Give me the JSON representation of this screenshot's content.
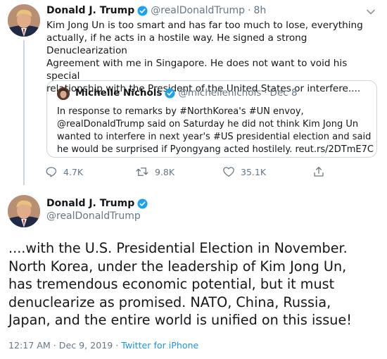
{
  "tweet1": {
    "name": "Donald J. Trump",
    "handle": "@realDonaldTrump",
    "separator": "·",
    "time": "8h",
    "lines": [
      "Kim Jong Un is too smart and has far too much to lose, everything",
      "actually, if he acts in a hostile way. He signed a strong Denuclearization",
      "Agreement with me in Singapore. He does not want to void his special",
      "relationship with the President of the United States or interfere...."
    ],
    "quote": {
      "name": "Michelle Nichols",
      "handle": "@michellenichols",
      "separator": "·",
      "time": "Dec 8",
      "lines": [
        "In response to remarks by #NorthKorea's #UN envoy,",
        "@realDonaldTrump said on Saturday he did not think Kim Jong Un",
        "wanted to interfere in next year's #US presidential election and said",
        "he would be surprised if Pyongyang acted hostilely. reut.rs/2DTmE7C"
      ]
    },
    "actions": {
      "reply_count": "4.7K",
      "retweet_count": "9.8K",
      "like_count": "35.1K"
    }
  },
  "tweet2": {
    "name": "Donald J. Trump",
    "handle": "@realDonaldTrump",
    "lines": [
      "....with the U.S. Presidential Election in November.",
      "North Korea, under the leadership of Kim Jong Un,",
      "has tremendous economic potential, but it must",
      "denuclearize as promised. NATO, China, Russia,",
      "Japan, and the entire world is unified on this issue!"
    ],
    "timestamp": "12:17 AM · Dec 9, 2019 · ",
    "source": "Twitter for iPhone"
  },
  "colors": {
    "accent": "#1da1f2",
    "text": "#14171a",
    "secondary": "#657786",
    "border": "#ccd6dd"
  },
  "icons": [
    "verified-badge-icon",
    "reply-icon",
    "retweet-icon",
    "like-icon",
    "share-icon"
  ]
}
